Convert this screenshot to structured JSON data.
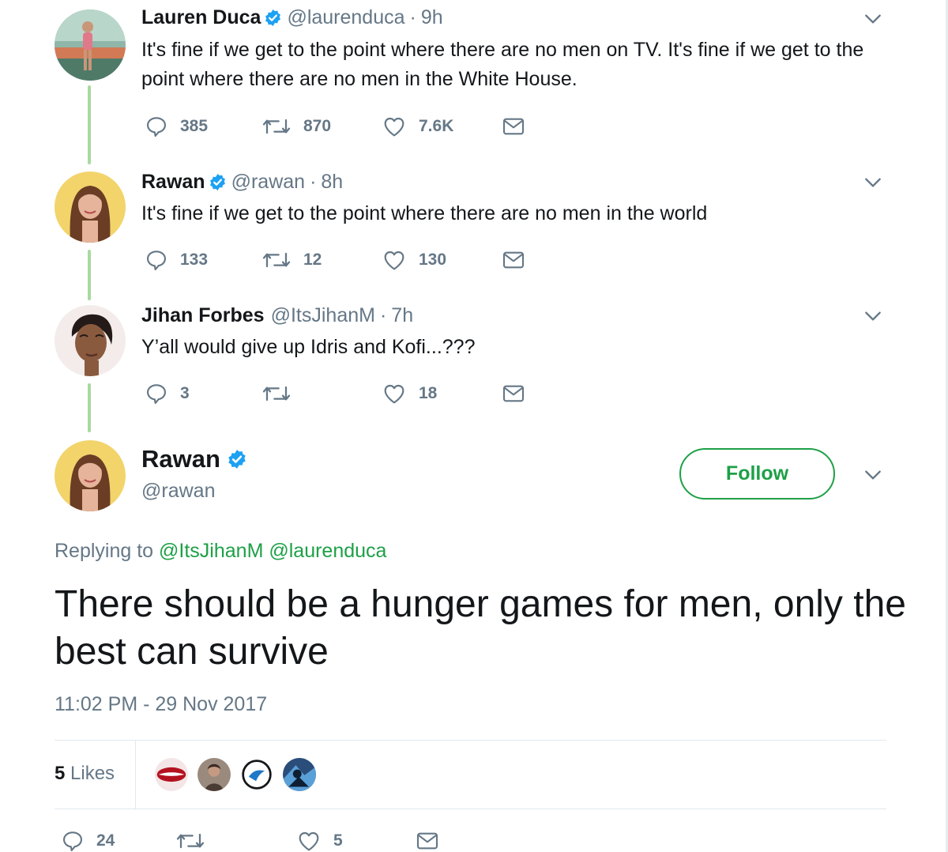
{
  "thread": [
    {
      "name": "Lauren Duca",
      "handle": "@laurenduca",
      "time": "9h",
      "text": "It's fine if we get to the point where there are no men on TV. It's fine if we get to the point where there are no men in the White House.",
      "replies": "385",
      "retweets": "870",
      "likes": "7.6K",
      "verified": true
    },
    {
      "name": "Rawan",
      "handle": "@rawan",
      "time": "8h",
      "text": "It's fine if we get to the point where there are no men in the world",
      "replies": "133",
      "retweets": "12",
      "likes": "130",
      "verified": true
    },
    {
      "name": "Jihan Forbes",
      "handle": "@ItsJihanM",
      "time": "7h",
      "text": "Y’all would give up Idris and Kofi...???",
      "replies": "3",
      "retweets": "",
      "likes": "18",
      "verified": false
    }
  ],
  "main_tweet": {
    "name": "Rawan",
    "handle": "@rawan",
    "follow_label": "Follow",
    "replying_prefix": "Replying to",
    "replying_to": [
      "@ItsJihanM",
      "@laurenduca"
    ],
    "text": "There should be a hunger games for men, only the best can survive",
    "timestamp": "11:02 PM - 29 Nov 2017",
    "likes_count": "5",
    "likes_label": "Likes",
    "replies": "24",
    "retweets": "",
    "likes": "5"
  },
  "colors": {
    "accent": "#1da047",
    "verified": "#1da1f2",
    "muted": "#657786",
    "thread_line": "#a9d9a0"
  },
  "icons": [
    "reply-icon",
    "retweet-icon",
    "like-icon",
    "dm-icon",
    "chevron-down-icon",
    "verified-badge-icon"
  ]
}
